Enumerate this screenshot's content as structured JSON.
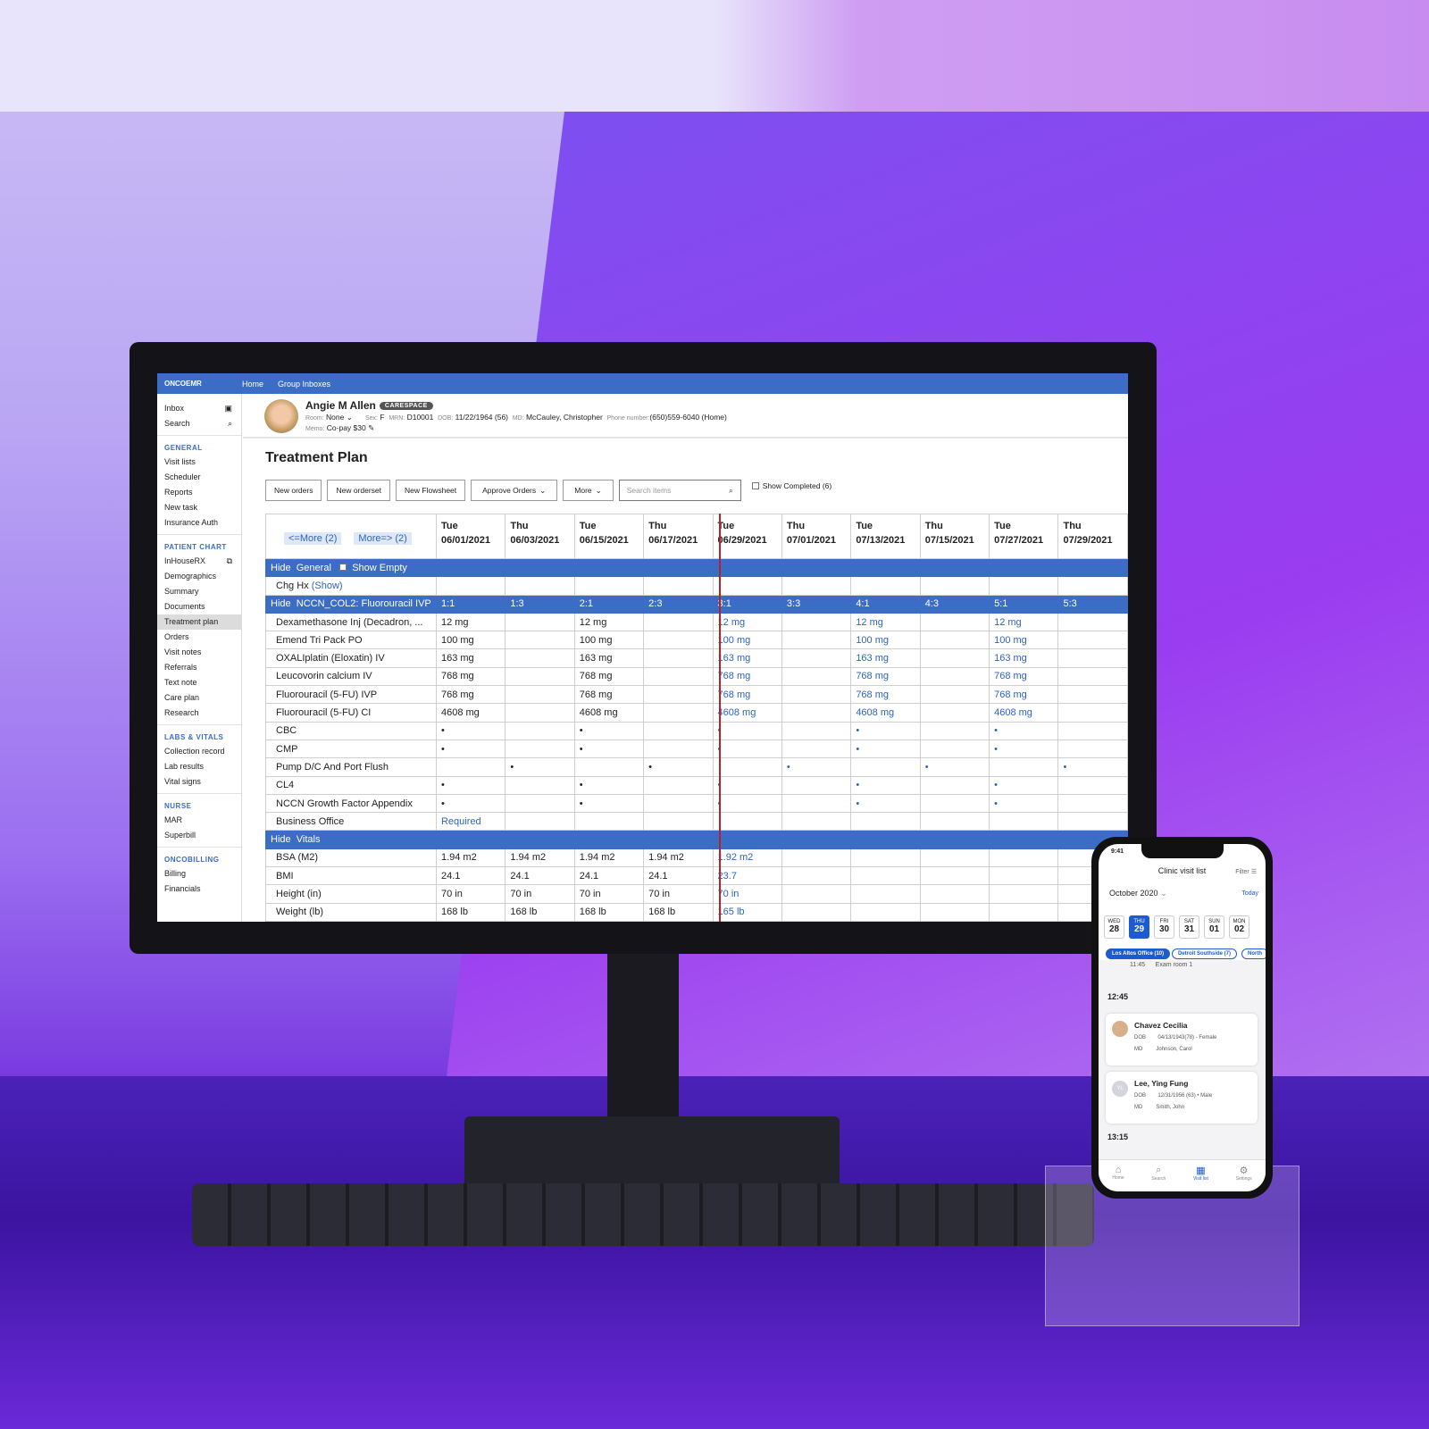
{
  "app": {
    "logo": "ONCOEMR",
    "nav": [
      "Home",
      "Group Inboxes"
    ]
  },
  "sidebar": {
    "top": [
      {
        "label": "Inbox",
        "icon": "inbox-icon"
      },
      {
        "label": "Search",
        "icon": "search-icon"
      }
    ],
    "sections": [
      {
        "title": "GENERAL",
        "items": [
          "Visit lists",
          "Scheduler",
          "Reports",
          "New task",
          "Insurance Auth"
        ]
      },
      {
        "title": "PATIENT CHART",
        "items": [
          "InHouseRX",
          "Demographics",
          "Summary",
          "Documents",
          "Treatment plan",
          "Orders",
          "Visit notes",
          "Referrals",
          "Text note",
          "Care plan",
          "Research"
        ]
      },
      {
        "title": "LABS & VITALS",
        "items": [
          "Collection record",
          "Lab results",
          "Vital signs"
        ]
      },
      {
        "title": "NURSE",
        "items": [
          "MAR",
          "Superbill"
        ]
      },
      {
        "title": "ONCOBILLING",
        "items": [
          "Billing",
          "Financials"
        ]
      }
    ],
    "active": "Treatment plan"
  },
  "patient": {
    "name": "Angie M Allen",
    "badge": "CARESPACE",
    "room_label": "Room:",
    "room": "None",
    "sex_label": "Sex:",
    "sex": "F",
    "mrn_label": "MRN:",
    "mrn": "D10001",
    "dob_label": "DOB:",
    "dob": "11/22/1964 (56)",
    "md_label": "MD:",
    "md": "McCauley, Christopher",
    "phone_label": "Phone number:",
    "phone": "(650)559-6040 (Home)",
    "memo_label": "Memo:",
    "memo": "Co-pay $30"
  },
  "page": {
    "title": "Treatment Plan"
  },
  "toolbar": {
    "new_orders": "New orders",
    "new_orderset": "New orderset",
    "new_flowsheet": "New Flowsheet",
    "approve_orders": "Approve Orders",
    "more": "More",
    "search_placeholder": "Search items",
    "show_completed": "Show Completed (6)"
  },
  "grid": {
    "more_prev": "<=More (2)",
    "more_next": "More=> (2)",
    "columns": [
      [
        "Tue",
        "06/01/2021"
      ],
      [
        "Thu",
        "06/03/2021"
      ],
      [
        "Tue",
        "06/15/2021"
      ],
      [
        "Thu",
        "06/17/2021"
      ],
      [
        "Tue",
        "06/29/2021"
      ],
      [
        "Thu",
        "07/01/2021"
      ],
      [
        "Tue",
        "07/13/2021"
      ],
      [
        "Thu",
        "07/15/2021"
      ],
      [
        "Tue",
        "07/27/2021"
      ],
      [
        "Thu",
        "07/29/2021"
      ]
    ],
    "rows": [
      {
        "type": "section",
        "hide": "Hide",
        "label": "General",
        "show_empty": "Show Empty"
      },
      {
        "label": "Chg Hx",
        "link": "(Show)",
        "values": [
          "",
          "",
          "",
          "",
          "",
          "",
          "",
          "",
          "",
          ""
        ]
      },
      {
        "type": "section",
        "hide": "Hide",
        "label": "NCCN_COL2: Fluorouracil IVP",
        "values": [
          "1:1",
          "1:3",
          "2:1",
          "2:3",
          "3:1",
          "3:3",
          "4:1",
          "4:3",
          "5:1",
          "5:3"
        ]
      },
      {
        "label": "Dexamethasone Inj (Decadron, ...",
        "values": [
          "12 mg",
          "",
          "12 mg",
          "",
          "12 mg",
          "",
          "12 mg",
          "",
          "12 mg",
          ""
        ]
      },
      {
        "label": "Emend Tri Pack PO",
        "values": [
          "100 mg",
          "",
          "100 mg",
          "",
          "100 mg",
          "",
          "100 mg",
          "",
          "100 mg",
          ""
        ]
      },
      {
        "label": "OXALIplatin (Eloxatin) IV",
        "values": [
          "163 mg",
          "",
          "163 mg",
          "",
          "163 mg",
          "",
          "163 mg",
          "",
          "163 mg",
          ""
        ]
      },
      {
        "label": "Leucovorin calcium IV",
        "values": [
          "768 mg",
          "",
          "768 mg",
          "",
          "768 mg",
          "",
          "768 mg",
          "",
          "768 mg",
          ""
        ]
      },
      {
        "label": "Fluorouracil (5-FU) IVP",
        "values": [
          "768 mg",
          "",
          "768 mg",
          "",
          "768 mg",
          "",
          "768 mg",
          "",
          "768 mg",
          ""
        ]
      },
      {
        "label": "Fluorouracil (5-FU) CI",
        "values": [
          "4608 mg",
          "",
          "4608 mg",
          "",
          "4608 mg",
          "",
          "4608 mg",
          "",
          "4608 mg",
          ""
        ]
      },
      {
        "label": "CBC",
        "values": [
          "•",
          "",
          "•",
          "",
          "•",
          "",
          "•",
          "",
          "•",
          ""
        ]
      },
      {
        "label": "CMP",
        "values": [
          "•",
          "",
          "•",
          "",
          "•",
          "",
          "•",
          "",
          "•",
          ""
        ]
      },
      {
        "label": "Pump D/C And Port Flush",
        "values": [
          "",
          "•",
          "",
          "•",
          "",
          "•",
          "",
          "•",
          "",
          "•"
        ]
      },
      {
        "label": "CL4",
        "values": [
          "•",
          "",
          "•",
          "",
          "•",
          "",
          "•",
          "",
          "•",
          ""
        ]
      },
      {
        "label": "NCCN Growth Factor Appendix",
        "values": [
          "•",
          "",
          "•",
          "",
          "•",
          "",
          "•",
          "",
          "•",
          ""
        ]
      },
      {
        "label": "Business Office",
        "values": [
          "Required",
          "",
          "",
          "",
          "",
          "",
          "",
          "",
          "",
          ""
        ]
      },
      {
        "type": "section",
        "hide": "Hide",
        "label": "Vitals"
      },
      {
        "label": "BSA (M2)",
        "values": [
          "1.94 m2",
          "1.94 m2",
          "1.94 m2",
          "1.94 m2",
          "1.92 m2",
          "",
          "",
          "",
          "",
          ""
        ]
      },
      {
        "label": "BMI",
        "values": [
          "24.1",
          "24.1",
          "24.1",
          "24.1",
          "23.7",
          "",
          "",
          "",
          "",
          ""
        ]
      },
      {
        "label": "Height (in)",
        "values": [
          "70 in",
          "70 in",
          "70 in",
          "70 in",
          "70 in",
          "",
          "",
          "",
          "",
          ""
        ]
      },
      {
        "label": "Weight (lb)",
        "values": [
          "168 lb",
          "168 lb",
          "168 lb",
          "168 lb",
          "165 lb",
          "",
          "",
          "",
          "",
          ""
        ]
      }
    ]
  },
  "phone": {
    "time": "9:41",
    "title": "Clinic visit list",
    "filter": "Filter",
    "month": "October 2020",
    "today": "Today",
    "days": [
      [
        "WED",
        "28"
      ],
      [
        "THU",
        "29"
      ],
      [
        "FRI",
        "30"
      ],
      [
        "SAT",
        "31"
      ],
      [
        "SUN",
        "01"
      ],
      [
        "MON",
        "02"
      ]
    ],
    "chips": [
      "Los Altos Office (10)",
      "Detroit Southside (7)",
      "North"
    ],
    "prev_time": "11:45",
    "prev_room": "Exam room 1",
    "slot1": "12:45",
    "slot2": "13:15",
    "patients": [
      {
        "name": "Chavez Cecilia",
        "dob_label": "DOB",
        "dob": "04/13/1943(78) - Female",
        "md_label": "MD",
        "md": "Johnson, Carol"
      },
      {
        "initials": "YL",
        "name": "Lee, Ying Fung",
        "dob_label": "DOB",
        "dob": "12/31/1956 (63) • Male",
        "md_label": "MD",
        "md": "Smith, John"
      }
    ],
    "tabs": [
      "Home",
      "Search",
      "Visit list",
      "Settings"
    ]
  },
  "colors": {
    "brand": "#3b6cc6",
    "today_line": "#b52424",
    "future_values": "#2c63c0"
  }
}
